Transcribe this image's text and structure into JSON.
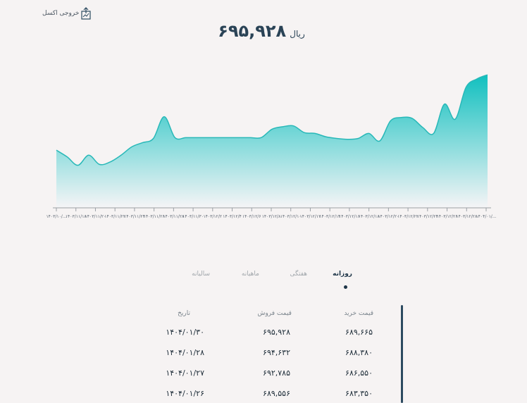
{
  "export": {
    "label": "خروجی اکسل"
  },
  "price": {
    "value": "۶۹۵,۹۲۸",
    "unit": "ریال"
  },
  "tabs": [
    {
      "label": "روزانه",
      "active": true
    },
    {
      "label": "هفتگی",
      "active": false
    },
    {
      "label": "ماهیانه",
      "active": false
    },
    {
      "label": "سالیانه",
      "active": false
    }
  ],
  "table": {
    "headers": {
      "buy": "قیمت خرید",
      "sell": "قیمت فروش",
      "date": "تاریخ"
    },
    "rows": [
      {
        "buy": "۶۸۹,۶۶۵",
        "sell": "۶۹۵,۹۲۸",
        "date": "۱۴۰۴/۰۱/۳۰"
      },
      {
        "buy": "۶۸۸,۳۸۰",
        "sell": "۶۹۴,۶۳۲",
        "date": "۱۴۰۴/۰۱/۲۸"
      },
      {
        "buy": "۶۸۶,۵۵۰",
        "sell": "۶۹۲,۷۸۵",
        "date": "۱۴۰۴/۰۱/۲۷"
      },
      {
        "buy": "۶۸۳,۳۵۰",
        "sell": "۶۸۹,۵۵۶",
        "date": "۱۴۰۴/۰۱/۲۶"
      }
    ]
  },
  "colors": {
    "line": "#28b8b8",
    "fill_top": "#11c0bf",
    "fill_bottom": "#f4f4f6",
    "axis": "#9aa0a6"
  },
  "chart_data": {
    "type": "area",
    "x": [
      "۱۴۰۳/۱۰/...",
      "۱۴۰۳/۱۱/۱۸",
      "۱۴۰۳/۱۱/۲۰",
      "۱۴۰۳/۱۱/۲۲",
      "۱۴۰۳/۱۱/۲۴",
      "۱۴۰۳/۱۱/۲۶",
      "۱۴۰۳/۱۱/۲۸",
      "۱۴۰۳/۱۱/۳۰",
      "۱۴۰۳/۱۲/۲",
      "۱۴۰۳/۱۲/۴",
      "۱۴۰۳/۱۲/۶",
      "۱۴۰۳/۱۲/۸",
      "۱۴۰۳/۱۲/۱۰",
      "۱۴۰۳/۱۲/۱۲",
      "۱۴۰۳/۱۲/۱۴",
      "۱۴۰۳/۱۲/۱۶",
      "۱۴۰۳/۱۲/۱۸",
      "۱۴۰۳/۱۲/۲۰",
      "۱۴۰۳/۱۲/۲۲",
      "۱۴۰۳/۱۲/۲۴",
      "۱۴۰۳/۱۲/۲۶",
      "۱۴۰۳/۱۲/۲۸",
      "۱۴۰۴/۰۱/..."
    ],
    "values": [
      628,
      620,
      610,
      622,
      611,
      614,
      622,
      632,
      637,
      642,
      668,
      643,
      643,
      643,
      643,
      643,
      643,
      643,
      643,
      643,
      653,
      656,
      657,
      649,
      648,
      644,
      642,
      641,
      642,
      648,
      639,
      663,
      667,
      666,
      655,
      648,
      683,
      665,
      703,
      713,
      718
    ],
    "ylim": [
      560,
      740
    ],
    "title": "",
    "xlabel": "",
    "ylabel": ""
  }
}
